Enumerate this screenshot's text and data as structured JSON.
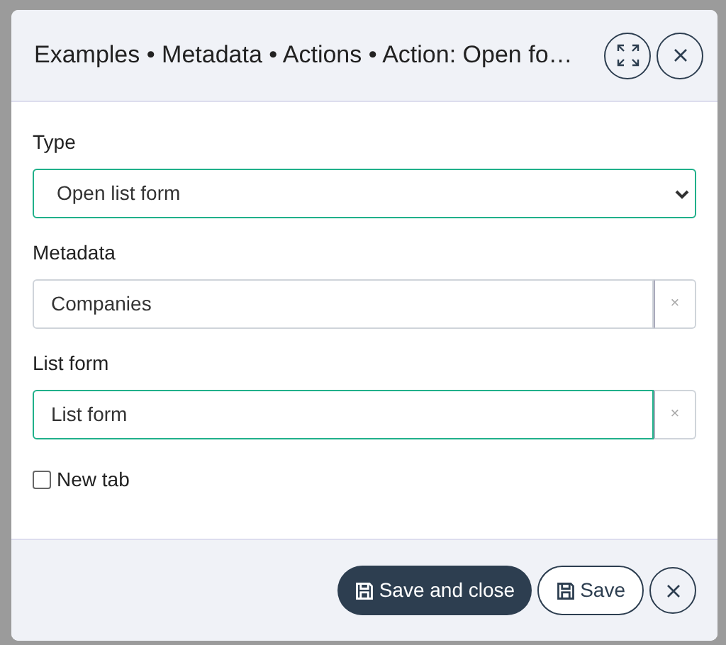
{
  "dialog": {
    "title": "Examples • Metadata • Actions • Action: Open fo…",
    "fields": [
      {
        "kind": "select",
        "label": "Type",
        "value": "Open list form",
        "focused": true
      },
      {
        "kind": "lookup",
        "label": "Metadata",
        "value": "Companies",
        "focused": false,
        "clear": "×"
      },
      {
        "kind": "lookup",
        "label": "List form",
        "value": "List form",
        "focused": true,
        "clear": "×"
      },
      {
        "kind": "checkbox",
        "label": "New tab",
        "checked": false
      }
    ],
    "buttons": [
      {
        "kind": "primary",
        "label": "Save and close"
      },
      {
        "kind": "secondary",
        "label": "Save"
      },
      {
        "kind": "close"
      }
    ]
  }
}
